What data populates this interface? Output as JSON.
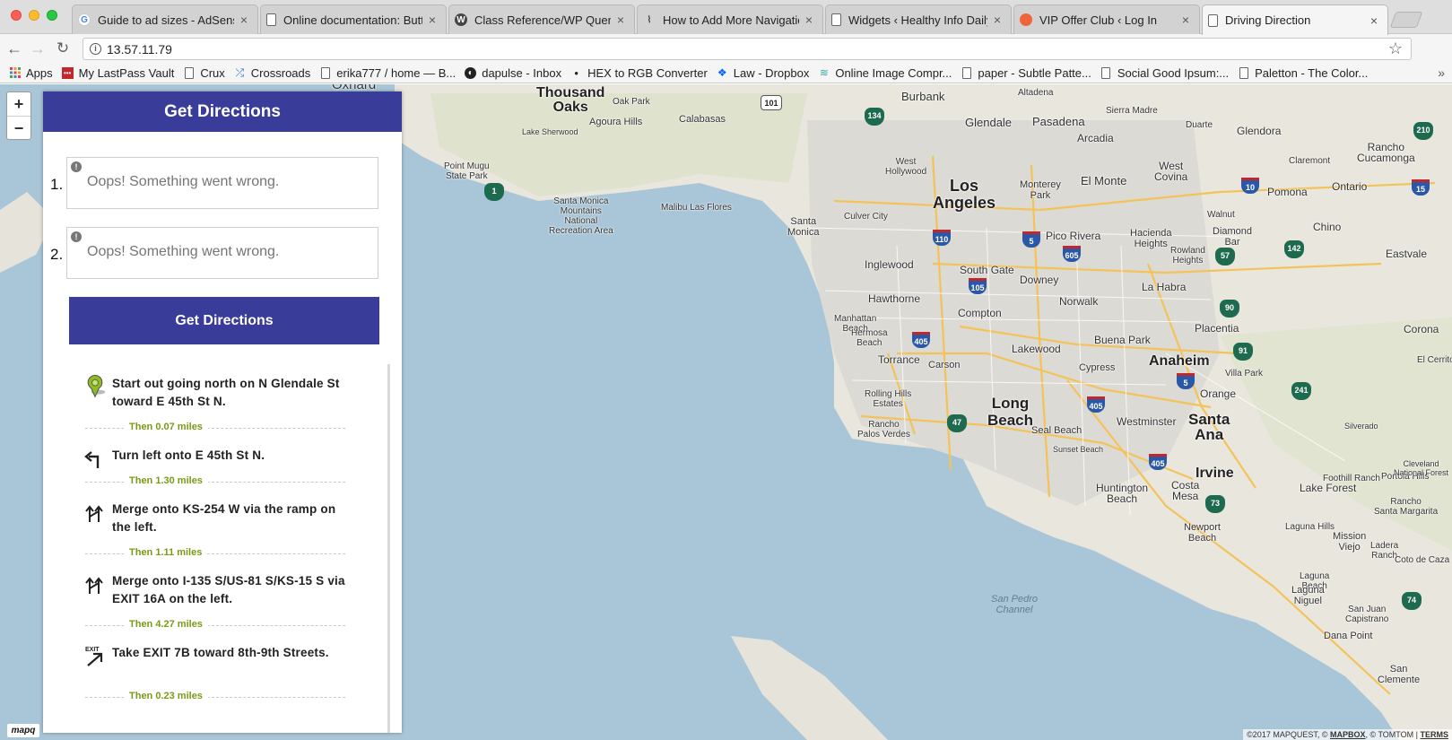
{
  "browser": {
    "tabs": [
      {
        "label": "Guide to ad sizes - AdSense",
        "favicon": "google-icon",
        "active": false
      },
      {
        "label": "Online documentation: Butt",
        "favicon": "page-icon",
        "active": false
      },
      {
        "label": "Class Reference/WP Query",
        "favicon": "wordpress-icon",
        "active": false
      },
      {
        "label": "How to Add More Navigatio",
        "favicon": "map-icon",
        "active": false
      },
      {
        "label": "Widgets ‹ Healthy Info Daily",
        "favicon": "page-icon",
        "active": false
      },
      {
        "label": "VIP Offer Club ‹ Log In",
        "favicon": "orange-circle-icon",
        "active": false
      },
      {
        "label": "Driving Direction",
        "favicon": "page-icon",
        "active": true
      }
    ],
    "url": "13.57.11.79",
    "bookmarks": [
      {
        "label": "Apps",
        "icon": "apps-grid-icon"
      },
      {
        "label": "My LastPass Vault",
        "icon": "lastpass-icon"
      },
      {
        "label": "Crux",
        "icon": "page-icon"
      },
      {
        "label": "Crossroads",
        "icon": "crossroads-icon"
      },
      {
        "label": "erika777 / home — B...",
        "icon": "page-icon"
      },
      {
        "label": "dapulse - Inbox",
        "icon": "dapulse-icon"
      },
      {
        "label": "HEX to RGB Converter",
        "icon": "dot-icon"
      },
      {
        "label": "Law - Dropbox",
        "icon": "dropbox-icon"
      },
      {
        "label": "Online Image Compr...",
        "icon": "wave-icon"
      },
      {
        "label": "paper - Subtle Patte...",
        "icon": "page-icon"
      },
      {
        "label": "Social Good Ipsum:...",
        "icon": "page-icon"
      },
      {
        "label": "Paletton - The Color...",
        "icon": "page-icon"
      }
    ]
  },
  "panel": {
    "title": "Get Directions",
    "waypoints": [
      {
        "number": "1.",
        "placeholder": "Oops! Something went wrong."
      },
      {
        "number": "2.",
        "placeholder": "Oops! Something went wrong."
      }
    ],
    "button_label": "Get Directions",
    "steps": [
      {
        "text": "Start out going north on N Glendale St toward E 45th St N.",
        "icon": "start-marker-icon",
        "distance": "Then 0.07 miles"
      },
      {
        "text": "Turn left onto E 45th St N.",
        "icon": "turn-left-icon",
        "distance": "Then 1.30 miles"
      },
      {
        "text": "Merge onto KS-254 W via the ramp on the left.",
        "icon": "merge-icon",
        "distance": "Then 1.11 miles"
      },
      {
        "text": "Merge onto I-135 S/US-81 S/KS-15 S via EXIT 16A on the left.",
        "icon": "merge-icon",
        "distance": "Then 4.27 miles"
      },
      {
        "text": "Take EXIT 7B toward 8th-9th Streets.",
        "icon": "exit-icon",
        "distance": "Then 0.23 miles"
      }
    ]
  },
  "map": {
    "zoom_in": "+",
    "zoom_out": "−",
    "logo": "mapq",
    "attribution": {
      "prefix": "©2017 MAPQUEST, ©",
      "mapbox": "MAPBOX",
      "tomtom": ", © TOMTOM |",
      "terms": "TERMS"
    },
    "places": {
      "oxnard": "Oxnard",
      "thousand_oaks": "Thousand\nOaks",
      "oak_park": "Oak Park",
      "agoura_hills": "Agoura Hills",
      "calabasas": "Calabasas",
      "lake_sherwood": "Lake Sherwood",
      "point_mugu": "Point Mugu\nState Park",
      "santa_monica_mtns": "Santa Monica\nMountains\nNational\nRecreation Area",
      "malibu": "Malibu Las Flores",
      "burbank": "Burbank",
      "altadena": "Altadena",
      "glendale": "Glendale",
      "pasadena": "Pasadena",
      "sierra_madre": "Sierra Madre",
      "duarte": "Duarte",
      "glendora": "Glendora",
      "arcadia": "Arcadia",
      "west_hollywood": "West\nHollywood",
      "los_angeles": "Los\nAngeles",
      "monterey_park": "Monterey\nPark",
      "el_monte": "El Monte",
      "west_covina": "West\nCovina",
      "pomona": "Pomona",
      "ontario": "Ontario",
      "rancho_cucamonga": "Rancho\nCucamonga",
      "claremont": "Claremont",
      "santa_monica": "Santa\nMonica",
      "culver_city": "Culver City",
      "pico_rivera": "Pico Rivera",
      "hacienda_heights": "Hacienda\nHeights",
      "diamond_bar": "Diamond\nBar",
      "walnut": "Walnut",
      "chino": "Chino",
      "eastvale": "Eastvale",
      "rowland_heights": "Rowland\nHeights",
      "inglewood": "Inglewood",
      "south_gate": "South Gate",
      "downey": "Downey",
      "hawthorne": "Hawthorne",
      "norwalk": "Norwalk",
      "la_habra": "La Habra",
      "compton": "Compton",
      "manhattan_beach": "Manhattan\nBeach",
      "hermosa_beach": "Hermosa\nBeach",
      "placentia": "Placentia",
      "buena_park": "Buena Park",
      "corona": "Corona",
      "torrance": "Torrance",
      "carson": "Carson",
      "lakewood": "Lakewood",
      "cypress": "Cypress",
      "anaheim": "Anaheim",
      "villa_park": "Villa Park",
      "el_cerrito": "El Cerrito",
      "rolling_hills": "Rolling Hills\nEstates",
      "long_beach": "Long\nBeach",
      "orange": "Orange",
      "westminster": "Westminster",
      "santa_ana": "Santa\nAna",
      "rancho_palos_verdes": "Rancho\nPalos Verdes",
      "seal_beach": "Seal Beach",
      "silverado": "Silverado",
      "sunset_beach": "Sunset Beach",
      "irvine": "Irvine",
      "huntington_beach": "Huntington\nBeach",
      "costa_mesa": "Costa\nMesa",
      "foothill_ranch": "Foothill Ranch",
      "lake_forest": "Lake Forest",
      "portola_hills": "Portola Hills",
      "cleveland_forest": "Cleveland\nNational Forest",
      "rancho_santa_margarita": "Rancho\nSanta Margarita",
      "newport_beach": "Newport\nBeach",
      "laguna_hills": "Laguna Hills",
      "mission_viejo": "Mission\nViejo",
      "ladera_ranch": "Ladera\nRanch",
      "laguna_beach": "Laguna\nBeach",
      "laguna_niguel": "Laguna\nNiguel",
      "coto_de_caza": "Coto de Caza",
      "san_juan_capistrano": "San Juan\nCapistrano",
      "dana_point": "Dana Point",
      "san_clemente": "San\nClemente",
      "san_pedro_channel": "San Pedro\nChannel"
    },
    "shields": {
      "i110": "110",
      "i5_a": "5",
      "i605": "605",
      "i105": "105",
      "i405_a": "405",
      "i405_b": "405",
      "i5_b": "5",
      "i405_c": "405",
      "i10": "10",
      "i15": "15",
      "s134": "134",
      "s1": "1",
      "s57": "57",
      "s90": "90",
      "s91": "91",
      "s241": "241",
      "s47": "47",
      "s73": "73",
      "s74": "74",
      "s142": "142",
      "s210": "210",
      "us101": "101"
    }
  }
}
